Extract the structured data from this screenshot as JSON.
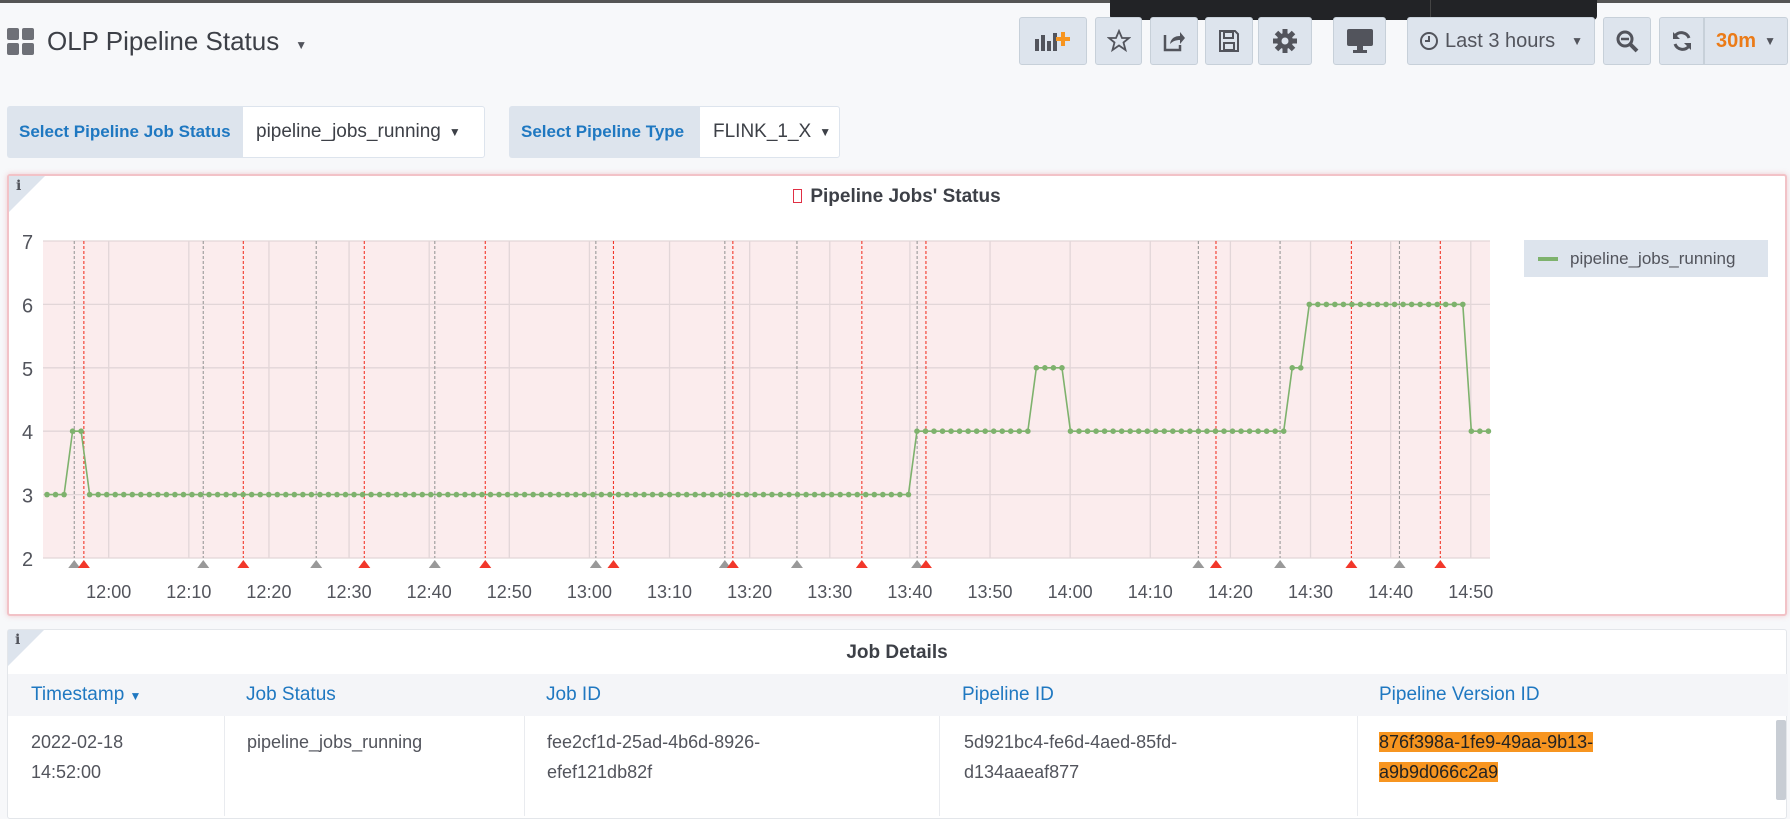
{
  "header": {
    "title": "OLP Pipeline Status"
  },
  "toolbar": {
    "add_panel": "add-panel-icon",
    "star": "star-icon",
    "share": "share-icon",
    "save": "save-icon",
    "settings": "gear-icon",
    "tv": "monitor-icon",
    "time_range": "Last 3 hours",
    "refresh_interval": "30m"
  },
  "variables": [
    {
      "label": "Select Pipeline Job Status",
      "value": "pipeline_jobs_running"
    },
    {
      "label": "Select Pipeline Type",
      "value": "FLINK_1_X"
    }
  ],
  "chart_panel": {
    "title": "Pipeline Jobs' Status",
    "info": "i"
  },
  "chart_data": {
    "type": "line",
    "title": "Pipeline Jobs' Status",
    "ylim": [
      2,
      7
    ],
    "yticks": [
      "2",
      "3",
      "4",
      "5",
      "6",
      "7"
    ],
    "xlim": [
      "11:51:48",
      "14:52:24"
    ],
    "xticks": [
      "12:00",
      "12:10",
      "12:20",
      "12:30",
      "12:40",
      "12:50",
      "13:00",
      "13:10",
      "13:20",
      "13:30",
      "13:40",
      "13:50",
      "14:00",
      "14:10",
      "14:20",
      "14:30",
      "14:40",
      "14:50"
    ],
    "series": [
      {
        "name": "pipeline_jobs_running",
        "color": "#7eb26d",
        "x_start": "11:52:18",
        "x_end": "14:52:12",
        "runs": [
          [
            3,
            3
          ],
          [
            4,
            2
          ],
          [
            3,
            97
          ],
          [
            4,
            14
          ],
          [
            5,
            4
          ],
          [
            4,
            26
          ],
          [
            5,
            2
          ],
          [
            6,
            19
          ],
          [
            4,
            3
          ]
        ]
      }
    ],
    "legend": "right",
    "annotations": [
      {
        "time": "11:55:42",
        "color": "#999999"
      },
      {
        "time": "11:56:54",
        "color": "#f2372a"
      },
      {
        "time": "12:11:48",
        "color": "#999999"
      },
      {
        "time": "12:16:48",
        "color": "#f2372a"
      },
      {
        "time": "12:25:54",
        "color": "#999999"
      },
      {
        "time": "12:31:54",
        "color": "#f2372a"
      },
      {
        "time": "12:40:42",
        "color": "#999999"
      },
      {
        "time": "12:47:00",
        "color": "#f2372a"
      },
      {
        "time": "13:00:48",
        "color": "#999999"
      },
      {
        "time": "13:03:00",
        "color": "#f2372a"
      },
      {
        "time": "13:16:54",
        "color": "#999999"
      },
      {
        "time": "13:17:54",
        "color": "#f2372a"
      },
      {
        "time": "13:25:54",
        "color": "#999999"
      },
      {
        "time": "13:34:00",
        "color": "#f2372a"
      },
      {
        "time": "13:40:54",
        "color": "#999999"
      },
      {
        "time": "13:42:00",
        "color": "#f2372a"
      },
      {
        "time": "14:16:00",
        "color": "#999999"
      },
      {
        "time": "14:18:12",
        "color": "#f2372a"
      },
      {
        "time": "14:26:12",
        "color": "#999999"
      },
      {
        "time": "14:35:06",
        "color": "#f2372a"
      },
      {
        "time": "14:41:06",
        "color": "#999999"
      },
      {
        "time": "14:46:12",
        "color": "#f2372a"
      }
    ]
  },
  "table_panel": {
    "title": "Job Details",
    "info": "i",
    "columns": [
      "Timestamp",
      "Job Status",
      "Job ID",
      "Pipeline ID",
      "Pipeline Version ID"
    ],
    "rows": [
      {
        "timestamp": [
          "2022-02-18",
          "14:52:00"
        ],
        "status": "pipeline_jobs_running",
        "job_id": [
          "fee2cf1d-25ad-4b6d-8926-",
          "efef121db82f"
        ],
        "pipeline_id": [
          "5d921bc4-fe6d-4aed-85fd-",
          "d134aaeaf877"
        ],
        "version_id": [
          "876f398a-1fe9-49aa-9b13-",
          "a9b9d066c2a9"
        ]
      }
    ]
  }
}
